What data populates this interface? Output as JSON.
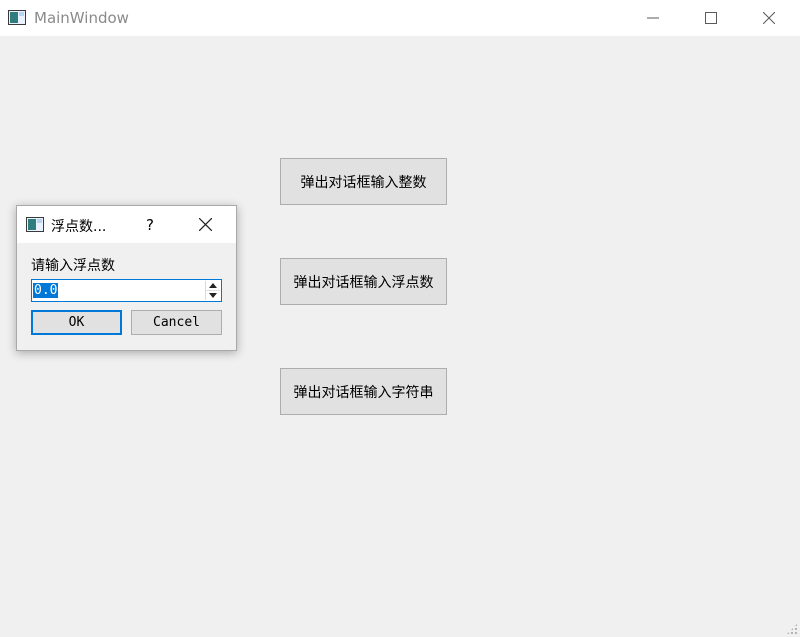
{
  "window": {
    "title": "MainWindow"
  },
  "buttons": {
    "input_int": "弹出对话框输入整数",
    "input_float": "弹出对话框输入浮点数",
    "input_string": "弹出对话框输入字符串"
  },
  "dialog": {
    "title": "浮点数...",
    "help": "?",
    "prompt": "请输入浮点数",
    "value": "0.0",
    "ok_label": "OK",
    "cancel_label": "Cancel"
  },
  "colors": {
    "accent": "#0078d7",
    "window_background": "#f0f0f0",
    "button_face": "#e1e1e1"
  },
  "icons": [
    "app-icon",
    "minimize-icon",
    "maximize-icon",
    "close-icon",
    "help-icon",
    "spin-up-icon",
    "spin-down-icon",
    "size-grip-icon"
  ]
}
